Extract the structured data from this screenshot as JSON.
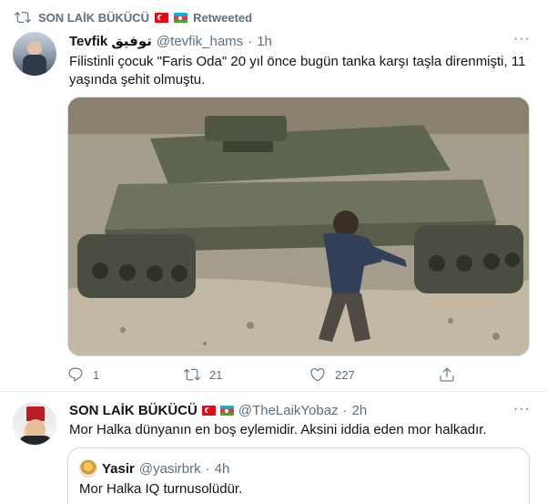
{
  "retweet": {
    "retweeter": "SON LAİK BÜKÜCÜ",
    "label": "Retweeted"
  },
  "tweet1": {
    "display_name": "Tevfik توفيق",
    "handle": "@tevfik_hams",
    "separator": "·",
    "time": "1h",
    "text": "Filistinli çocuk \"Faris Oda\" 20 yıl önce bugün tanka karşı taşla direnmişti, 11 yaşında şehit olmuştu.",
    "more": "···",
    "replies": "1",
    "retweets": "21",
    "likes": "227"
  },
  "tweet2": {
    "display_name": "SON LAİK BÜKÜCÜ",
    "handle": "@TheLaikYobaz",
    "separator": "·",
    "time": "2h",
    "text": "Mor Halka dünyanın en boş eylemidir. Aksini iddia eden mor halkadır.",
    "more": "···",
    "quote": {
      "display_name": "Yasir",
      "handle": "@yasirbrk",
      "separator": "·",
      "time": "4h",
      "text": "Mor Halka IQ turnusolüdür."
    }
  },
  "colors": {
    "secondary_text": "#5b7083",
    "primary_text": "#0f1419",
    "divider": "#e6ecf0"
  }
}
